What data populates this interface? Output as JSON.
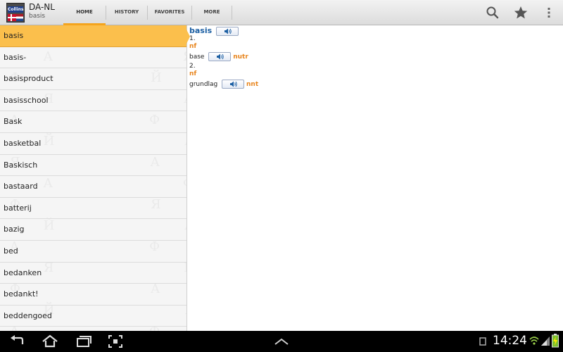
{
  "header": {
    "app_title": "DA-NL",
    "current_word": "basis",
    "logo_brand": "Collins",
    "tabs": [
      {
        "label": "HOME",
        "active": true
      },
      {
        "label": "HISTORY",
        "active": false
      },
      {
        "label": "FAVORITES",
        "active": false
      },
      {
        "label": "MORE",
        "active": false
      }
    ],
    "icons": [
      "search-icon",
      "star-icon",
      "overflow-menu-icon"
    ]
  },
  "word_list": [
    "basis",
    "basis-",
    "basisproduct",
    "basisschool",
    "Bask",
    "basketbal",
    "Baskisch",
    "bastaard",
    "batterij",
    "bazig",
    "bed",
    "bedanken",
    "bedankt!",
    "beddengoed"
  ],
  "entry": {
    "headword": "basis",
    "senses": [
      {
        "number": "1.",
        "pos": "nf",
        "translation": "base",
        "gender": "nutr"
      },
      {
        "number": "2.",
        "pos": "nf",
        "translation": "grundlag",
        "gender": "nnt"
      }
    ]
  },
  "status_bar": {
    "time": "14:24"
  },
  "colors": {
    "accent": "#fbbf4c",
    "headword": "#1c5fa3",
    "grammar": "#e8861f"
  }
}
